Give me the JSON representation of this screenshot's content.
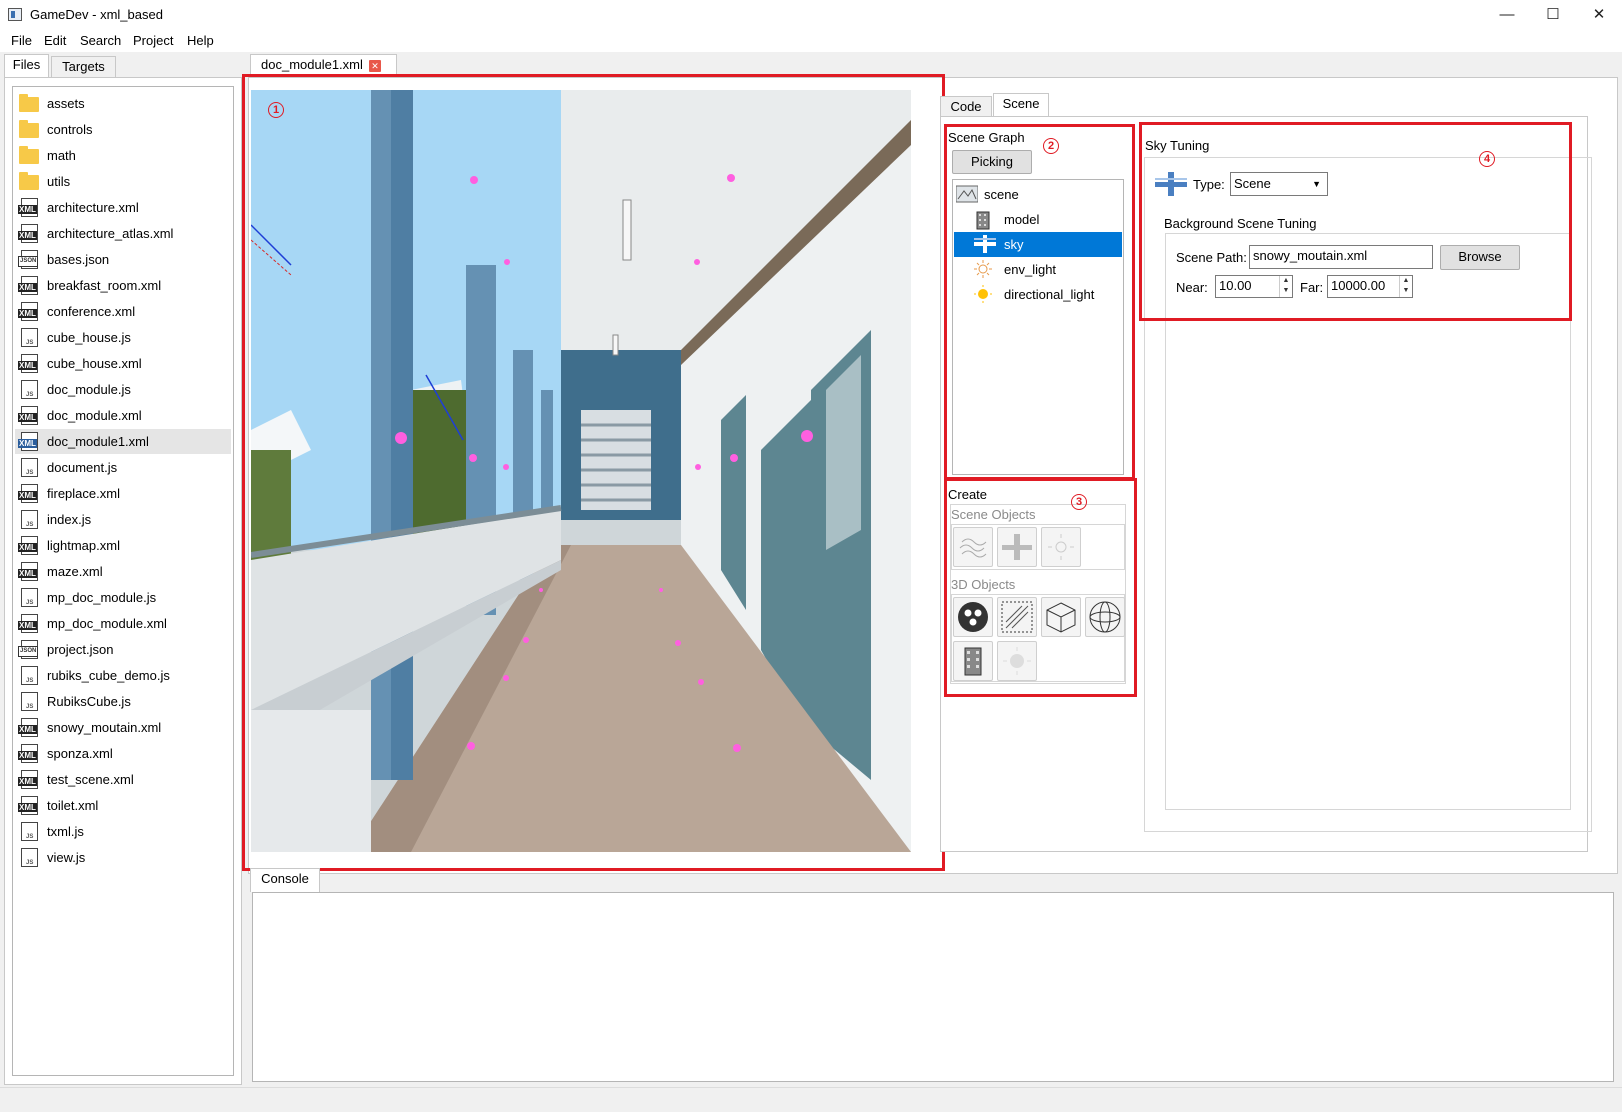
{
  "window": {
    "title": "GameDev - xml_based",
    "minimize": "—",
    "maximize": "☐",
    "close": "✕"
  },
  "menu": {
    "file": "File",
    "edit": "Edit",
    "search": "Search",
    "project": "Project",
    "help": "Help"
  },
  "left_tabs": {
    "files": "Files",
    "targets": "Targets"
  },
  "files": [
    {
      "name": "assets",
      "type": "folder"
    },
    {
      "name": "controls",
      "type": "folder"
    },
    {
      "name": "math",
      "type": "folder"
    },
    {
      "name": "utils",
      "type": "folder"
    },
    {
      "name": "architecture.xml",
      "type": "xml"
    },
    {
      "name": "architecture_atlas.xml",
      "type": "xml"
    },
    {
      "name": "bases.json",
      "type": "json"
    },
    {
      "name": "breakfast_room.xml",
      "type": "xml"
    },
    {
      "name": "conference.xml",
      "type": "xml"
    },
    {
      "name": "cube_house.js",
      "type": "js"
    },
    {
      "name": "cube_house.xml",
      "type": "xml"
    },
    {
      "name": "doc_module.js",
      "type": "js"
    },
    {
      "name": "doc_module.xml",
      "type": "xml"
    },
    {
      "name": "doc_module1.xml",
      "type": "xml",
      "selected": true
    },
    {
      "name": "document.js",
      "type": "js"
    },
    {
      "name": "fireplace.xml",
      "type": "xml"
    },
    {
      "name": "index.js",
      "type": "js"
    },
    {
      "name": "lightmap.xml",
      "type": "xml"
    },
    {
      "name": "maze.xml",
      "type": "xml"
    },
    {
      "name": "mp_doc_module.js",
      "type": "js"
    },
    {
      "name": "mp_doc_module.xml",
      "type": "xml"
    },
    {
      "name": "project.json",
      "type": "json"
    },
    {
      "name": "rubiks_cube_demo.js",
      "type": "js"
    },
    {
      "name": "RubiksCube.js",
      "type": "js"
    },
    {
      "name": "snowy_moutain.xml",
      "type": "xml"
    },
    {
      "name": "sponza.xml",
      "type": "xml"
    },
    {
      "name": "test_scene.xml",
      "type": "xml"
    },
    {
      "name": "toilet.xml",
      "type": "xml"
    },
    {
      "name": "txml.js",
      "type": "js"
    },
    {
      "name": "view.js",
      "type": "js"
    }
  ],
  "file_icon_tags": {
    "xml": "XML",
    "json": "JSON",
    "js": "JS"
  },
  "editor_tab": {
    "label": "doc_module1.xml",
    "close": "✕"
  },
  "markers": {
    "m1": "1",
    "m2": "2",
    "m3": "3",
    "m4": "4"
  },
  "right_tabs": {
    "code": "Code",
    "scene": "Scene"
  },
  "scene_graph": {
    "title": "Scene Graph",
    "picking": "Picking",
    "nodes": [
      {
        "label": "scene",
        "icon": "scene-icon"
      },
      {
        "label": "model",
        "icon": "building-icon"
      },
      {
        "label": "sky",
        "icon": "sky-icon",
        "selected": true
      },
      {
        "label": "env_light",
        "icon": "env-light-icon"
      },
      {
        "label": "directional_light",
        "icon": "sun-icon"
      }
    ]
  },
  "create": {
    "title": "Create",
    "scene_objects": "Scene Objects",
    "objects_3d": "3D Objects",
    "scene_object_icons": [
      "fog-icon",
      "sky-icon",
      "light-icon"
    ],
    "object_3d_icons": [
      "group-icon",
      "plane-icon",
      "box-icon",
      "sphere-icon",
      "model-icon",
      "env-light-icon"
    ]
  },
  "sky_tuning": {
    "title": "Sky Tuning",
    "type_label": "Type:",
    "type_value": "Scene",
    "bg_title": "Background Scene Tuning",
    "path_label": "Scene Path:",
    "path_value": "snowy_moutain.xml",
    "browse": "Browse",
    "near_label": "Near:",
    "near_value": "10.00",
    "far_label": "Far:",
    "far_value": "10000.00"
  },
  "console": {
    "tab": "Console"
  },
  "colors": {
    "accent": "#0078d7",
    "highlight_box": "#e01b24",
    "selection_gray": "#e5e5e5"
  }
}
